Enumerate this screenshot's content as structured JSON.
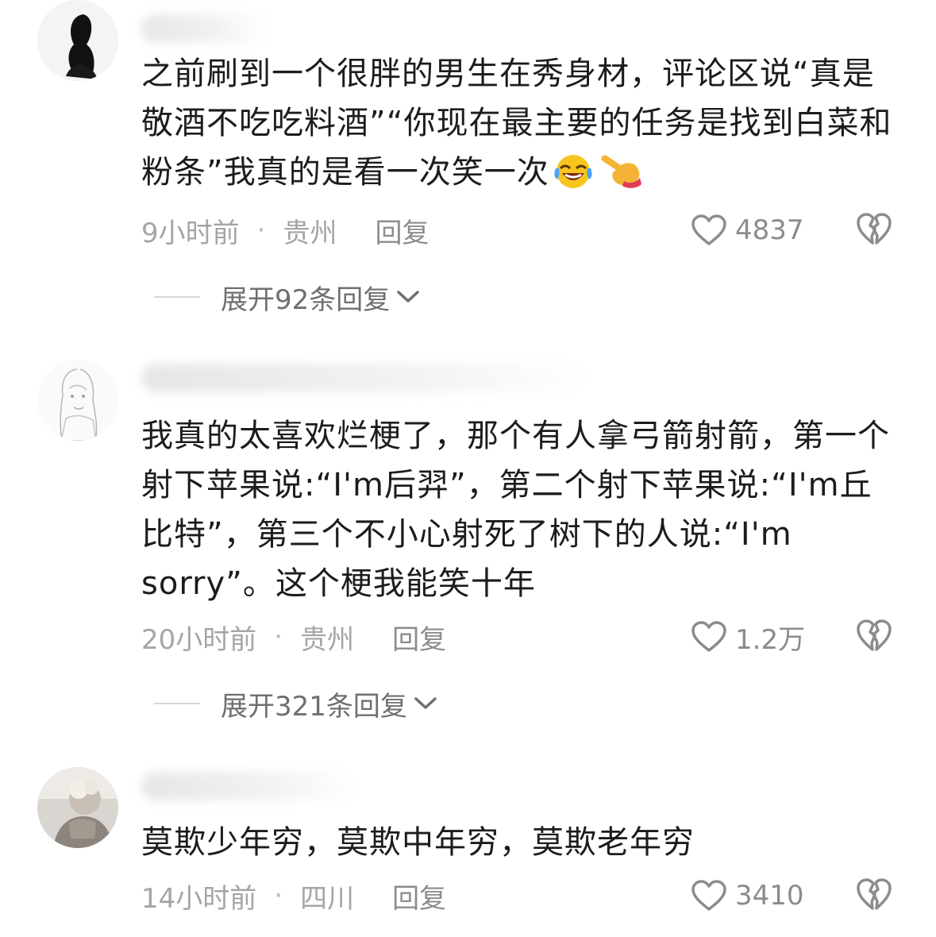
{
  "comments": [
    {
      "content": "之前刷到一个很胖的男生在秀身材，评论区说“真是敬酒不吃吃料酒”“你现在最主要的任务是找到白菜和粉条”我真的是看一次笑一次",
      "time": "9小时前",
      "separator": "·",
      "location": "贵州",
      "reply_label": "回复",
      "likes": "4837",
      "expand_label": "展开92条回复",
      "emojis": [
        "rolling-on-floor-laughing",
        "backhand-index-pointing-right"
      ]
    },
    {
      "content": "我真的太喜欢烂梗了，那个有人拿弓箭射箭，第一个射下苹果说:“I'm后羿”，第二个射下苹果说:“I'm丘比特”，第三个不小心射死了树下的人说:“I'm sorry”。这个梗我能笑十年",
      "time": "20小时前",
      "separator": "·",
      "location": "贵州",
      "reply_label": "回复",
      "likes": "1.2万",
      "expand_label": "展开321条回复"
    },
    {
      "content": "莫欺少年穷，莫欺中年穷，莫欺老年穷",
      "time": "14小时前",
      "separator": "·",
      "location": "四川",
      "reply_label": "回复",
      "likes": "3410"
    }
  ],
  "icons": {
    "like": "heart-outline-icon",
    "dislike": "broken-heart-icon",
    "expand": "chevron-down-icon"
  },
  "colors": {
    "text": "#1c1c1c",
    "meta": "#a5a5a5",
    "action": "#8c8c8c"
  }
}
